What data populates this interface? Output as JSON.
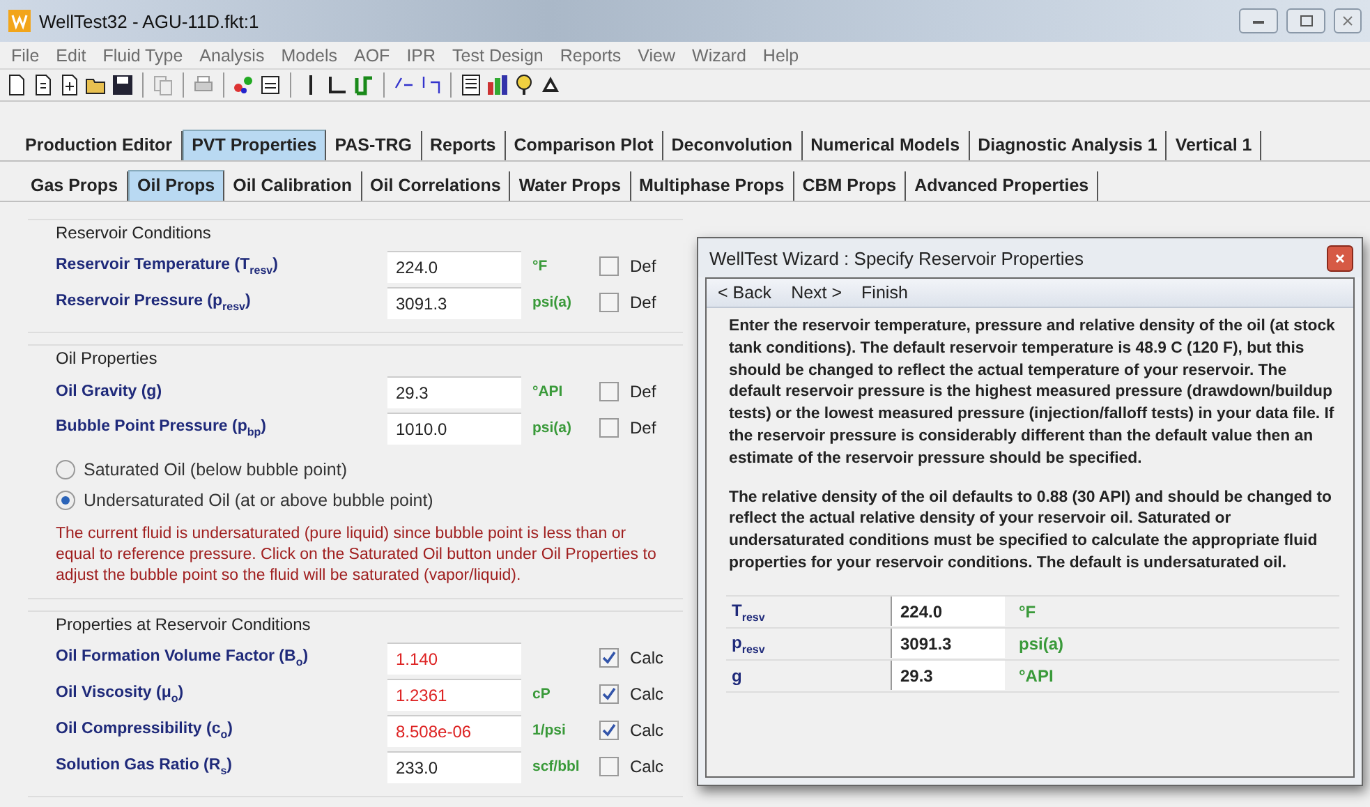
{
  "window": {
    "title": "WellTest32 - AGU-11D.fkt:1"
  },
  "menu": [
    "File",
    "Edit",
    "Fluid Type",
    "Analysis",
    "Models",
    "AOF",
    "IPR",
    "Test Design",
    "Reports",
    "View",
    "Wizard",
    "Help"
  ],
  "tabs": [
    {
      "label": "Production Editor",
      "selected": false
    },
    {
      "label": "PVT Properties",
      "selected": true
    },
    {
      "label": "PAS-TRG",
      "selected": false
    },
    {
      "label": "Reports",
      "selected": false
    },
    {
      "label": "Comparison Plot",
      "selected": false
    },
    {
      "label": "Deconvolution",
      "selected": false
    },
    {
      "label": "Numerical Models",
      "selected": false
    },
    {
      "label": "Diagnostic Analysis 1",
      "selected": false
    },
    {
      "label": "Vertical 1",
      "selected": false
    }
  ],
  "subtabs": [
    {
      "label": "Gas Props",
      "selected": false
    },
    {
      "label": "Oil Props",
      "selected": true
    },
    {
      "label": "Oil Calibration",
      "selected": false
    },
    {
      "label": "Oil Correlations",
      "selected": false
    },
    {
      "label": "Water Props",
      "selected": false
    },
    {
      "label": "Multiphase Props",
      "selected": false
    },
    {
      "label": "CBM Props",
      "selected": false
    },
    {
      "label": "Advanced Properties",
      "selected": false
    }
  ],
  "groups": [
    {
      "title": "Reservoir Conditions",
      "rows": [
        {
          "label": "Reservoir Temperature (T$_{resv}$)",
          "value": "224.0",
          "computed": false,
          "unit": "°F",
          "check_label": "Def",
          "checked": false
        },
        {
          "label": "Reservoir Pressure (p$_{resv}$)",
          "value": "3091.3",
          "computed": false,
          "unit": "psi(a)",
          "check_label": "Def",
          "checked": false
        }
      ]
    },
    {
      "title": "Oil Properties",
      "rows": [
        {
          "label": "Oil Gravity (g)",
          "value": "29.3",
          "computed": false,
          "unit": "°API",
          "check_label": "Def",
          "checked": false
        },
        {
          "label": "Bubble Point Pressure (p$_{bp}$)",
          "value": "1010.0",
          "computed": false,
          "unit": "psi(a)",
          "check_label": "Def",
          "checked": false
        }
      ],
      "options": [
        {
          "label": "Saturated Oil (below bubble point)",
          "selected": false
        },
        {
          "label": "Undersaturated Oil (at or above bubble point)",
          "selected": true
        }
      ],
      "note": "The current fluid is undersaturated (pure liquid) since bubble point is less than or equal to reference pressure.  Click on the Saturated Oil button under Oil Properties to adjust the bubble point so the fluid will be saturated (vapor/liquid)."
    },
    {
      "title": "Properties at Reservoir Conditions",
      "rows": [
        {
          "label": "Oil Formation Volume Factor (B$_{o}$)",
          "value": "1.140",
          "computed": true,
          "check_label": "Calc",
          "checked": true
        },
        {
          "label": "Oil Viscosity (μ$_{o}$)",
          "value": "1.2361",
          "computed": true,
          "unit": "cP",
          "check_label": "Calc",
          "checked": true
        },
        {
          "label": "Oil Compressibility (c$_{o}$)",
          "value": "8.508e-06",
          "computed": true,
          "unit": "1/psi",
          "check_label": "Calc",
          "checked": true
        },
        {
          "label": "Solution Gas Ratio (R$_{s}$)",
          "value": "233.0",
          "computed": false,
          "unit": "scf/bbl",
          "check_label": "Calc",
          "checked": false
        }
      ]
    }
  ],
  "dialog": {
    "title": "WellTest Wizard : Specify Reservoir Properties",
    "nav": [
      "< Back",
      "Next >",
      "Finish"
    ],
    "paragraphs": [
      "Enter the reservoir temperature, pressure and relative density of the oil (at stock tank conditions).  The default reservoir temperature is 48.9 C (120 F), but this should be changed to reflect the actual temperature of your reservoir.  The default reservoir pressure is the highest measured pressure (drawdown/buildup tests) or the lowest measured pressure (injection/falloff tests) in your data file.  If the reservoir pressure is considerably different than the default value then an estimate of the reservoir pressure should be specified.",
      "The relative density of the oil defaults to 0.88 (30 API) and should be changed to reflect the actual relative density of your reservoir oil.  Saturated or undersaturated conditions must be specified to calculate the appropriate fluid properties for your reservoir conditions.  The default is undersaturated oil."
    ],
    "params": [
      {
        "label": "T$_{resv}$",
        "value": "224.0",
        "unit": "°F"
      },
      {
        "label": "p$_{resv}$",
        "value": "3091.3",
        "unit": "psi(a)"
      },
      {
        "label": "g",
        "value": "29.3",
        "unit": "°API"
      }
    ]
  }
}
